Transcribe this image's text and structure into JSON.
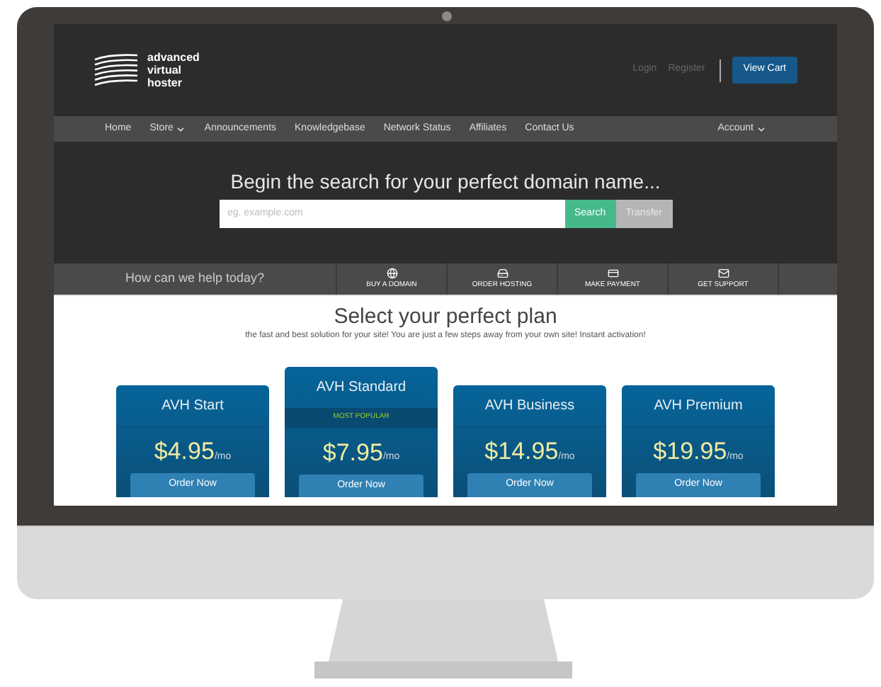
{
  "header": {
    "logo_lines": [
      "advanced",
      "virtual",
      "hoster"
    ],
    "links": [
      "Login",
      "Register"
    ],
    "cart_button": "View Cart"
  },
  "nav": {
    "items": [
      {
        "label": "Home",
        "dropdown": false
      },
      {
        "label": "Store",
        "dropdown": true
      },
      {
        "label": "Announcements",
        "dropdown": false
      },
      {
        "label": "Knowledgebase",
        "dropdown": false
      },
      {
        "label": "Network Status",
        "dropdown": false
      },
      {
        "label": "Affiliates",
        "dropdown": false
      },
      {
        "label": "Contact Us",
        "dropdown": false
      }
    ],
    "account": {
      "label": "Account",
      "dropdown": true
    }
  },
  "hero": {
    "title": "Begin the search for your perfect domain name...",
    "placeholder": "eg. example.com",
    "buttons": [
      {
        "label": "Search",
        "kind": "primary"
      },
      {
        "label": "Transfer",
        "kind": "secondary"
      }
    ]
  },
  "help": {
    "label": "How can we help today?",
    "items": [
      {
        "label": "BUY A DOMAIN",
        "kind": "globe"
      },
      {
        "label": "ORDER HOSTING",
        "kind": "drive"
      },
      {
        "label": "MAKE PAYMENT",
        "kind": "card"
      },
      {
        "label": "GET SUPPORT",
        "kind": "mail"
      }
    ]
  },
  "plans": {
    "title": "Select your perfect plan",
    "subtitle": "the fast and best solution for your site! You are just a few steps away from your own site! Instant activation!",
    "items": [
      {
        "name": "AVH Start",
        "price": "$4.95",
        "period": "/mo",
        "button": "Order Now"
      },
      {
        "name": "AVH Standard",
        "badge": "MOST POPULAR",
        "price": "$7.95",
        "period": "/mo",
        "button": "Order Now"
      },
      {
        "name": "AVH Business",
        "price": "$14.95",
        "period": "/mo",
        "button": "Order Now"
      },
      {
        "name": "AVH Premium",
        "price": "$19.95",
        "period": "/mo",
        "button": "Order Now"
      }
    ]
  }
}
